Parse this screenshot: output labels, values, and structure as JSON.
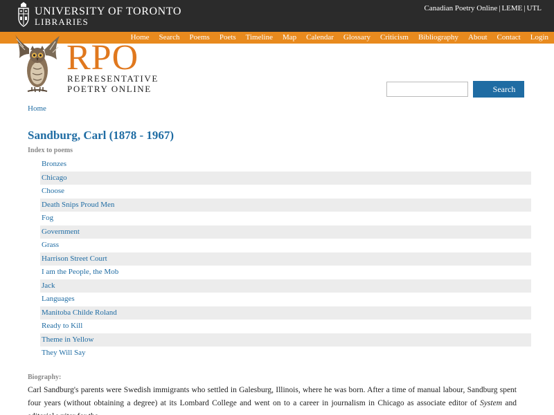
{
  "header": {
    "ut_line1": "UNIVERSITY  OF  TORONTO",
    "ut_line2": "LIBRARIES",
    "top_links": [
      "Canadian Poetry Online",
      "LEME",
      "UTL"
    ]
  },
  "nav": {
    "items": [
      "Home",
      "Search",
      "Poems",
      "Poets",
      "Timeline",
      "Map",
      "Calendar",
      "Glossary",
      "Criticism",
      "Bibliography",
      "About",
      "Contact",
      "Login"
    ]
  },
  "logo": {
    "big": "RPO",
    "line1": "REPRESENTATIVE",
    "line2": "POETRY  ONLINE"
  },
  "search": {
    "value": "",
    "button_label": "Search"
  },
  "breadcrumb": "Home",
  "poet": {
    "title": "Sandburg, Carl (1878 - 1967)",
    "index_label": "Index to poems",
    "poems": [
      "Bronzes",
      "Chicago",
      "Choose",
      "Death Snips Proud Men",
      "Fog",
      "Government",
      "Grass",
      "Harrison Street Court",
      "I am the People, the Mob",
      "Jack",
      "Languages",
      "Manitoba Childe Roland",
      "Ready to Kill",
      "Theme in Yellow",
      "They Will Say"
    ],
    "bio_label": "Biography:",
    "bio_part1": "Carl Sandburg's parents were Swedish immigrants who settled in Galesburg, Illinois, where he was born. After a time of manual labour, Sandburg spent four years (without obtaining a degree) at its Lombard College and went on to a career in journalism in Chicago as associate editor of ",
    "bio_italic": "System",
    "bio_part2": " and editorial writer for the"
  },
  "colors": {
    "topbar": "#2b2b2b",
    "nav_orange": "#e88a1e",
    "rpo_orange": "#e0781e",
    "link_blue": "#1f6ca3",
    "stripe": "#ececec"
  }
}
